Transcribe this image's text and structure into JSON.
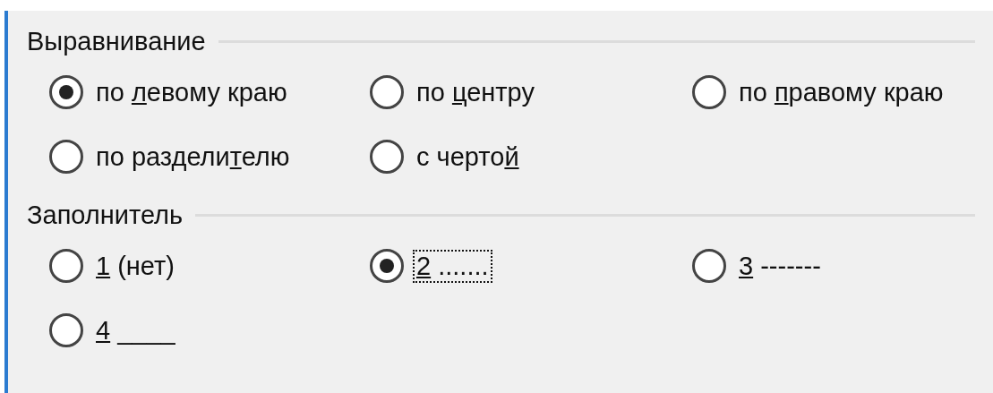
{
  "groups": [
    {
      "title": "Выравнивание",
      "options": [
        {
          "pre": "по ",
          "key": "л",
          "post": "евому краю",
          "selected": true,
          "focused": false
        },
        {
          "pre": "по ",
          "key": "ц",
          "post": "ентру",
          "selected": false,
          "focused": false
        },
        {
          "pre": "по ",
          "key": "п",
          "post": "равому краю",
          "selected": false,
          "focused": false
        },
        {
          "pre": "по раздели",
          "key": "т",
          "post": "елю",
          "selected": false,
          "focused": false
        },
        {
          "pre": "с черто",
          "key": "й",
          "selected": false,
          "focused": false
        }
      ]
    },
    {
      "title": "Заполнитель",
      "options": [
        {
          "key": "1",
          "post": " (нет)",
          "selected": false,
          "focused": false
        },
        {
          "key": "2",
          "post": " .......",
          "selected": true,
          "focused": true
        },
        {
          "key": "3",
          "post": " -------",
          "selected": false,
          "focused": false
        },
        {
          "key": "4",
          "post": " ____",
          "selected": false,
          "focused": false
        }
      ]
    }
  ]
}
